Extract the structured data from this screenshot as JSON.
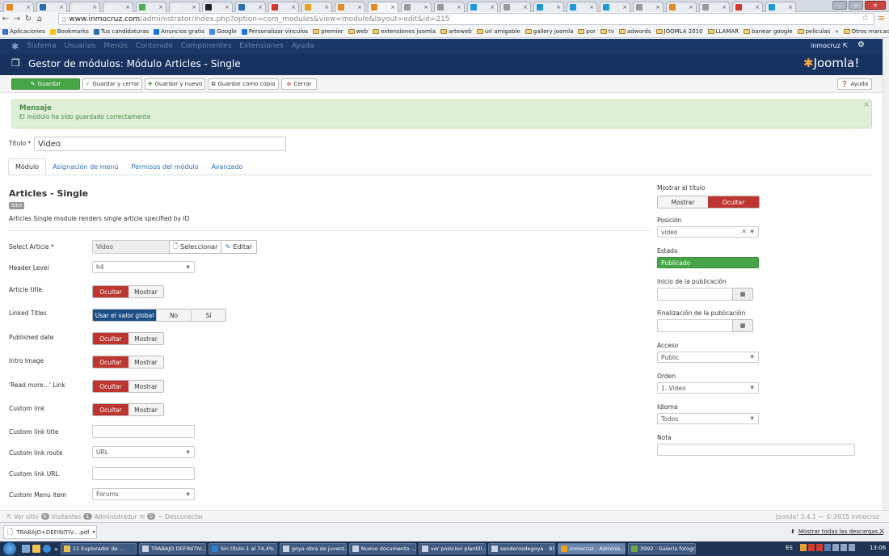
{
  "browser": {
    "tabs": [
      {
        "fav": "#e28a25"
      },
      {
        "fav": "#2a6fb6"
      },
      {
        "fav": "#f0f0f0"
      },
      {
        "fav": "#f0f0f0"
      },
      {
        "fav": "#4caf50"
      },
      {
        "fav": "#f0f0f0"
      },
      {
        "fav": "#222222"
      },
      {
        "fav": "#2a6fb6"
      },
      {
        "fav": "#d9362b"
      },
      {
        "fav": "#e9a21a"
      },
      {
        "fav": "#e28a25"
      },
      {
        "fav": "#e28a25",
        "active": true
      },
      {
        "fav": "#999999"
      },
      {
        "fav": "#999999"
      },
      {
        "fav": "#1d9bd8"
      },
      {
        "fav": "#999999"
      },
      {
        "fav": "#1d9bd8"
      },
      {
        "fav": "#1d9bd8"
      },
      {
        "fav": "#1d9bd8"
      },
      {
        "fav": "#999999"
      },
      {
        "fav": "#e28a25"
      },
      {
        "fav": "#999999"
      },
      {
        "fav": "#d9362b"
      },
      {
        "fav": "#1d9bd8"
      }
    ],
    "url_host": "www.inmocruz.com",
    "url_path": "/administrator/index.php?option=com_modules&view=module&layout=edit&id=215",
    "bookmarks": [
      "Aplicaciones",
      "Bookmarks",
      "Tus candidaturas",
      "Anuncios gratis",
      "Google",
      "Personalizar vínculos",
      "premier",
      "web",
      "extensiones joomla",
      "arteweb",
      "url amigable",
      "gallery joomla",
      "por",
      "tv",
      "adwords",
      "JOOMLA 2010",
      "LLAMAR",
      "banear google",
      "peliculas"
    ],
    "bookmarks_more": "»",
    "bookmarks_other": "Otros marcadores"
  },
  "joomla": {
    "menu": [
      "Sistema",
      "Usuarios",
      "Menús",
      "Contenido",
      "Componentes",
      "Extensiones",
      "Ayuda"
    ],
    "user": "inmocruz",
    "page_title": "Gestor de módulos: Módulo Articles - Single",
    "logo_text": "Joomla!",
    "toolbar": {
      "save": "Guardar",
      "save_close": "Guardar y cerrar",
      "save_new": "Guardar y nuevo",
      "save_copy": "Guardar como copia",
      "close": "Cerrar",
      "help": "Ayuda"
    },
    "alert": {
      "title": "Mensaje",
      "text": "El módulo ha sido guardado correctamente",
      "close": "×"
    },
    "title_label": "Título *",
    "title_value": "Video",
    "tabs": [
      "Módulo",
      "Asignación de menú",
      "Permisos del módulo",
      "Avanzado"
    ],
    "module": {
      "name": "Articles - Single",
      "badge": "Sitio",
      "description": "Articles Single module renders single article specified by ID"
    },
    "fields": {
      "select_article_label": "Select Article *",
      "select_article_value": "Video",
      "select_btn": "Seleccionar",
      "edit_btn": "Editar",
      "header_level_label": "Header Level",
      "header_level_value": "h4",
      "article_title_label": "Article title",
      "linked_titles_label": "Linked Titles",
      "use_global": "Usar el valor global",
      "no": "No",
      "yes": "Sí",
      "published_date_label": "Published date",
      "intro_image_label": "Intro Image",
      "read_more_label": "'Read more...' Link",
      "custom_link_label": "Custom link",
      "custom_link_title_label": "Custom link title",
      "custom_link_route_label": "Custom link route",
      "custom_link_route_value": "URL",
      "custom_link_url_label": "Custom link URL",
      "custom_menu_item_label": "Custom Menu item",
      "custom_menu_item_value": "Forums",
      "hide": "Ocultar",
      "show": "Mostrar"
    },
    "sidebar": {
      "show_title_label": "Mostrar el título",
      "show": "Mostrar",
      "hide": "Ocultar",
      "position_label": "Posición",
      "position_value": "video",
      "status_label": "Estado",
      "status_value": "Publicado",
      "publish_start_label": "Inicio de la publicación",
      "publish_end_label": "Finalización de la publicación",
      "access_label": "Acceso",
      "access_value": "Public",
      "order_label": "Orden",
      "order_value": "1. Video",
      "language_label": "Idioma",
      "language_value": "Todos",
      "note_label": "Nota"
    },
    "status": {
      "view_site": "Ver sitio",
      "visitors_count": "0",
      "visitors": "Visitantes",
      "admin_count": "1",
      "admin": "Administrador",
      "msg_count": "0",
      "logout": "Desconectar",
      "version": "Joomla! 3.4.1 — © 2015 inmocruz"
    }
  },
  "downloads": {
    "file": "TRABAJO+DEFINITIV....pdf",
    "show_all": "Mostrar todas las descargas...",
    "close": "×"
  },
  "taskbar": {
    "items": [
      "11 Explorador de ...",
      "TRABAJO DEFINITIV...",
      "Sin título-1 al 74,4% ...",
      "goya obra de juvent...",
      "Nuevo documento ...",
      "ver posicion plantill...",
      "senderosdegoya - Bl...",
      "inmocruz - Adminis...",
      "3992 - Galería fotogr..."
    ],
    "active_index": 7,
    "lang": "ES",
    "time": "13:06"
  }
}
